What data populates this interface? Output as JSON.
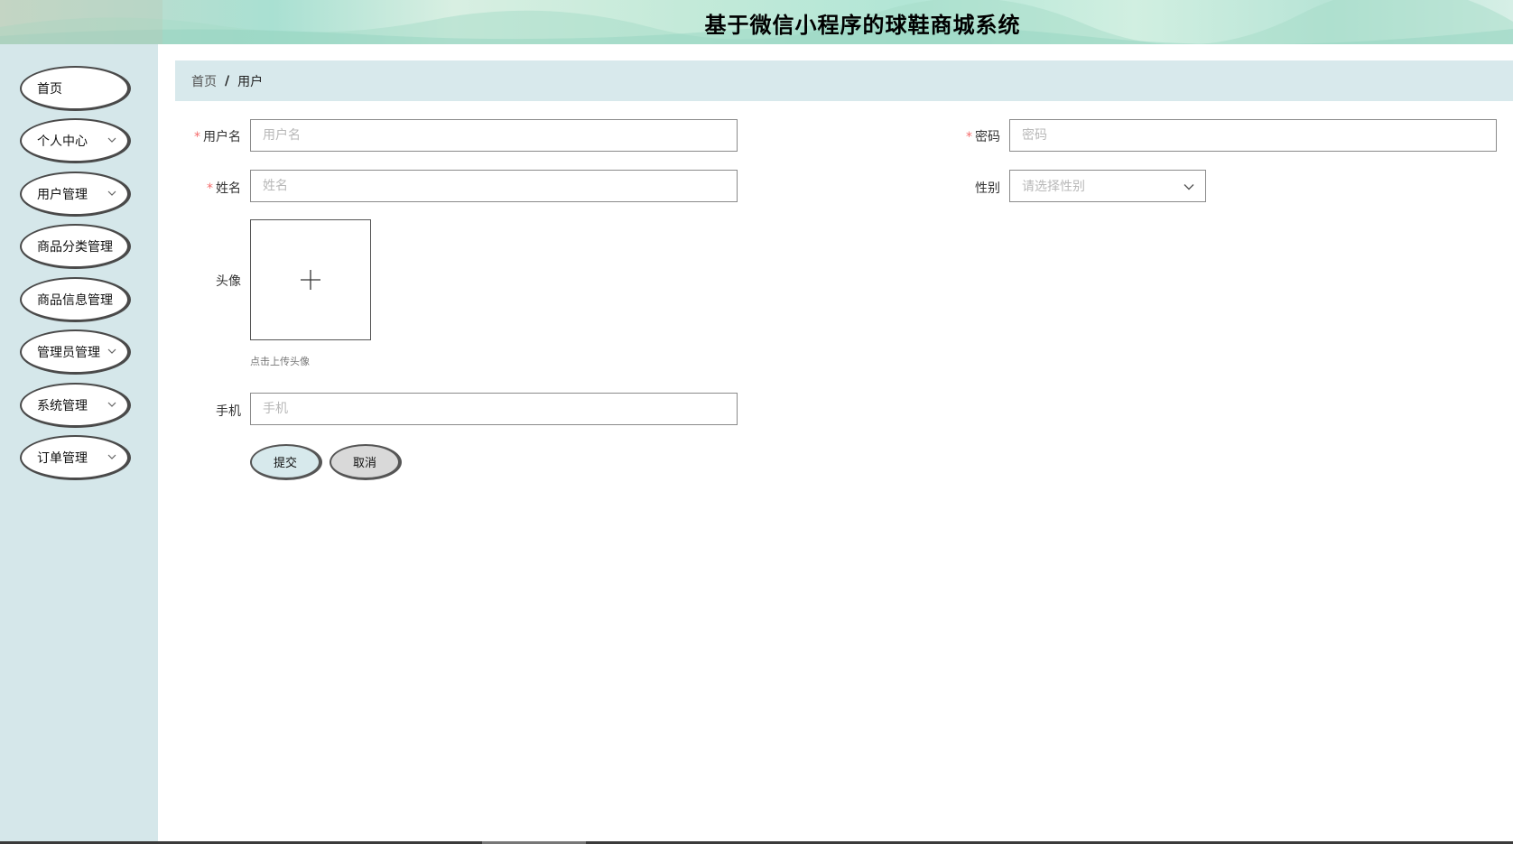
{
  "header": {
    "title": "基于微信小程序的球鞋商城系统"
  },
  "sidebar": {
    "items": [
      {
        "label": "首页",
        "expandable": false
      },
      {
        "label": "个人中心",
        "expandable": true
      },
      {
        "label": "用户管理",
        "expandable": true
      },
      {
        "label": "商品分类管理",
        "expandable": false
      },
      {
        "label": "商品信息管理",
        "expandable": false
      },
      {
        "label": "管理员管理",
        "expandable": true
      },
      {
        "label": "系统管理",
        "expandable": true
      },
      {
        "label": "订单管理",
        "expandable": true
      }
    ]
  },
  "breadcrumb": {
    "home": "首页",
    "separator": "/",
    "current": "用户"
  },
  "form": {
    "username": {
      "label": "用户名",
      "placeholder": "用户名",
      "value": "",
      "required": true
    },
    "password": {
      "label": "密码",
      "placeholder": "密码",
      "value": "",
      "required": true
    },
    "name": {
      "label": "姓名",
      "placeholder": "姓名",
      "value": "",
      "required": true
    },
    "gender": {
      "label": "性别",
      "placeholder": "请选择性别",
      "value": ""
    },
    "avatar": {
      "label": "头像",
      "tip": "点击上传头像"
    },
    "phone": {
      "label": "手机",
      "placeholder": "手机",
      "value": ""
    },
    "submit_label": "提交",
    "cancel_label": "取消"
  },
  "colors": {
    "sidebar_bg": "#d5e7ea",
    "breadcrumb_bg": "#d8e9ec",
    "required_star": "#f56c6c",
    "submit_bg": "#d7e9ec",
    "cancel_bg": "#d9d9d9"
  }
}
